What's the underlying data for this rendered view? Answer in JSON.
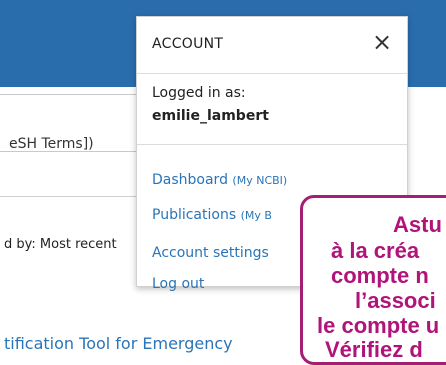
{
  "topbar": {
    "color": "#2a6dad"
  },
  "background_page": {
    "search_text": "eSH Terms])",
    "sort_text": "d by: Most recent",
    "article_text": "tification Tool for Emergency"
  },
  "account_panel": {
    "title": "ACCOUNT",
    "close_icon": "×",
    "logged_in_label": "Logged in as:",
    "username": "emilie_lambert",
    "links": {
      "dashboard": "Dashboard",
      "dashboard_suffix": "(My NCBI)",
      "publications": "Publications",
      "publications_suffix": "(My B",
      "account_settings": "Account settings",
      "log_out": "Log out"
    }
  },
  "tip_overlay": {
    "line1": "Astu",
    "line2": "à la créa",
    "line3": "compte n",
    "line4": "l’associ",
    "line5": "le compte u",
    "line6": "Vérifiez d",
    "color": "#b0137a"
  }
}
